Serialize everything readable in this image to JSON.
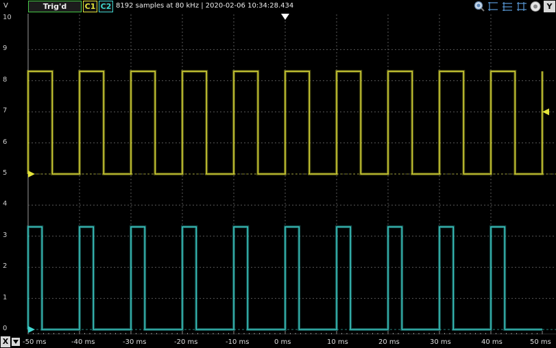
{
  "toolbar": {
    "y_unit": "V",
    "trigger_status": "Trig'd",
    "channel1_label": "C1",
    "channel2_label": "C2",
    "acquisition_info": "8192 samples at 80 kHz | 2020-02-06 10:34:28.434",
    "y_button": "Y",
    "icons": [
      "zoom-icon",
      "cursor-icon",
      "cursor-icon",
      "cursor-icon",
      "settings-icon"
    ]
  },
  "axes": {
    "y_ticks": [
      "10",
      "9",
      "8",
      "7",
      "6",
      "5",
      "4",
      "3",
      "2",
      "1",
      "0"
    ],
    "x_ticks": [
      "-50 ms",
      "-40 ms",
      "-30 ms",
      "-20 ms",
      "-10 ms",
      "0 ms",
      "10 ms",
      "20 ms",
      "30 ms",
      "40 ms",
      "50 ms"
    ],
    "x_button": "X"
  },
  "colors": {
    "channel1": "#e3e33a",
    "channel2": "#3fd6d0",
    "trigger_ok": "#46c846",
    "grid": "#5a5a5a"
  },
  "chart_data": {
    "type": "line",
    "x_unit": "ms",
    "y_unit": "V",
    "xlim": [
      -50,
      50
    ],
    "ylim": [
      0,
      10
    ],
    "grid": true,
    "series": [
      {
        "name": "C1",
        "high": 8.3,
        "low": 5.0,
        "offset_marker": 5.0,
        "trigger_level": 7.0,
        "pulses_ms": [
          [
            -50,
            -45.3
          ],
          [
            -40,
            -35.3
          ],
          [
            -30,
            -25.3
          ],
          [
            -20,
            -15.3
          ],
          [
            -10,
            -5.3
          ],
          [
            0,
            4.7
          ],
          [
            10,
            14.7
          ],
          [
            20,
            24.7
          ],
          [
            30,
            34.7
          ],
          [
            40,
            44.7
          ],
          [
            50,
            50
          ]
        ]
      },
      {
        "name": "C2",
        "high": 3.3,
        "low": 0.0,
        "offset_marker": 0.0,
        "pulses_ms": [
          [
            -50,
            -47.3
          ],
          [
            -40,
            -37.3
          ],
          [
            -30,
            -27.3
          ],
          [
            -20,
            -17.3
          ],
          [
            -10,
            -7.3
          ],
          [
            0,
            2.7
          ],
          [
            10,
            12.7
          ],
          [
            20,
            22.7
          ],
          [
            30,
            32.7
          ],
          [
            40,
            42.7
          ]
        ]
      }
    ]
  }
}
